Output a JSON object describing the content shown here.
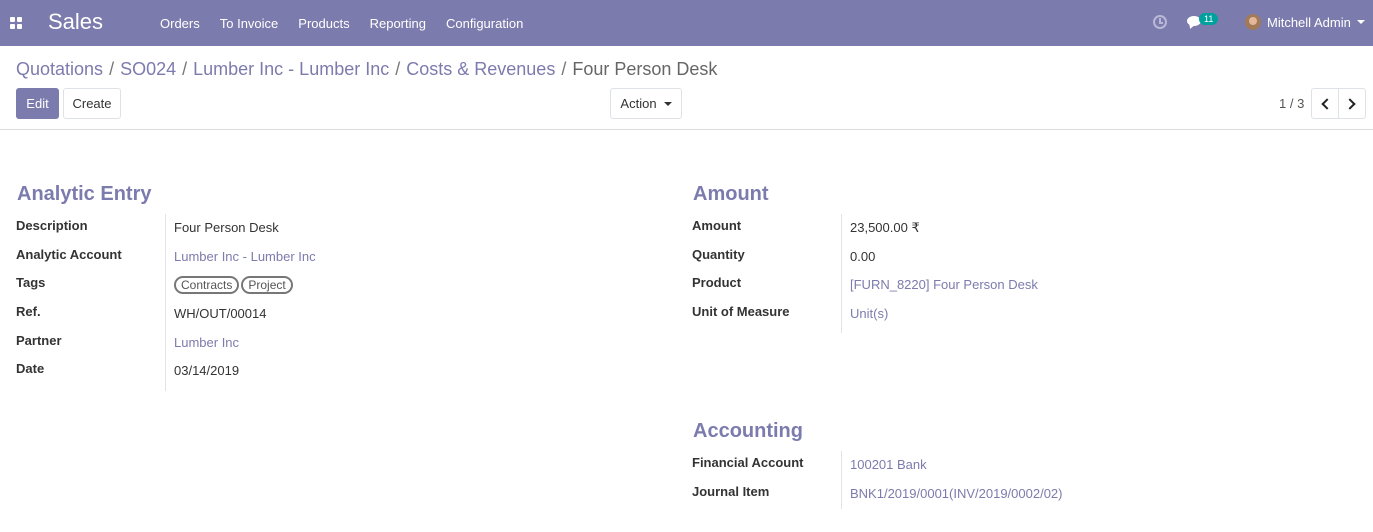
{
  "navbar": {
    "app_name": "Sales",
    "menu": [
      "Orders",
      "To Invoice",
      "Products",
      "Reporting",
      "Configuration"
    ],
    "message_count": "11",
    "user_name": "Mitchell Admin"
  },
  "breadcrumb": {
    "items": [
      "Quotations",
      "SO024",
      "Lumber Inc - Lumber Inc",
      "Costs & Revenues"
    ],
    "current": "Four Person Desk"
  },
  "toolbar": {
    "edit_label": "Edit",
    "create_label": "Create",
    "action_label": "Action"
  },
  "pager": {
    "value": "1 / 3"
  },
  "analytic_entry": {
    "title": "Analytic Entry",
    "description_label": "Description",
    "description": "Four Person Desk",
    "account_label": "Analytic Account",
    "account": "Lumber Inc - Lumber Inc",
    "tags_label": "Tags",
    "tags": [
      "Contracts",
      "Project"
    ],
    "ref_label": "Ref.",
    "ref": "WH/OUT/00014",
    "partner_label": "Partner",
    "partner": "Lumber Inc",
    "date_label": "Date",
    "date": "03/14/2019"
  },
  "amount": {
    "title": "Amount",
    "amount_label": "Amount",
    "amount": "23,500.00 ₹",
    "quantity_label": "Quantity",
    "quantity": "0.00",
    "product_label": "Product",
    "product": "[FURN_8220] Four Person Desk",
    "uom_label": "Unit of Measure",
    "uom": "Unit(s)"
  },
  "accounting": {
    "title": "Accounting",
    "financial_account_label": "Financial Account",
    "financial_account": "100201 Bank",
    "journal_item_label": "Journal Item",
    "journal_item": "BNK1/2019/0001(INV/2019/0002/02)"
  },
  "colors": {
    "brand": "#7c7bad",
    "badge": "#00a09d"
  }
}
